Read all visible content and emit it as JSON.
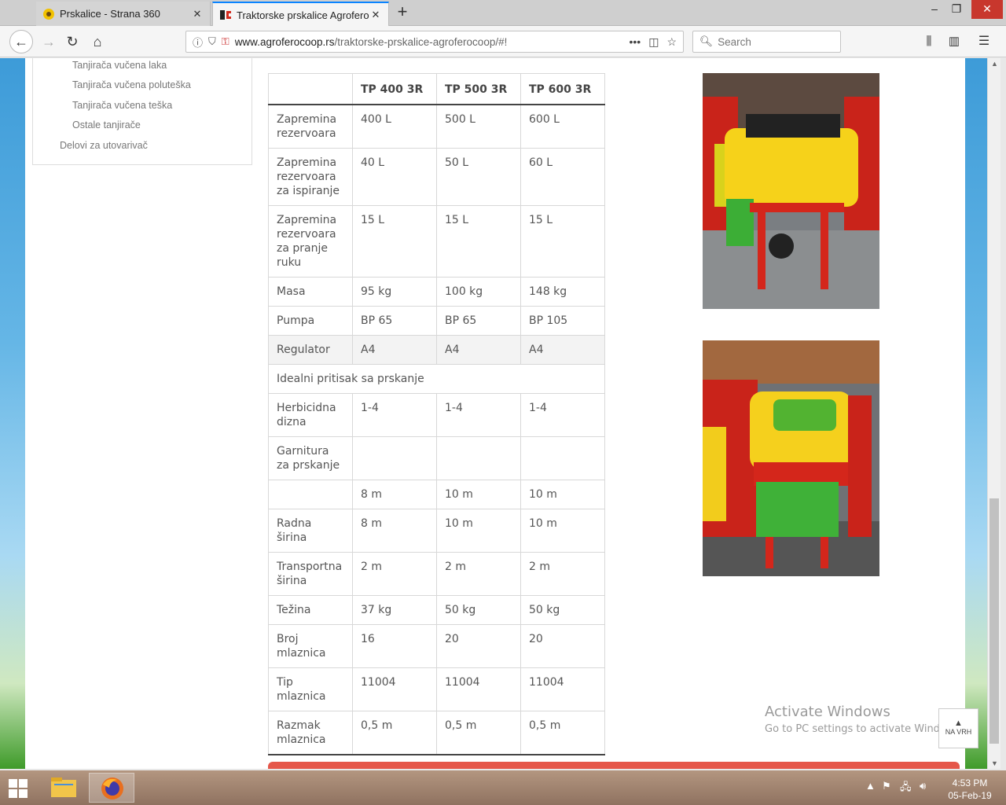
{
  "browser": {
    "tabs": [
      {
        "title": "Prskalice - Strana 360",
        "active": false
      },
      {
        "title": "Traktorske prskalice Agroferoc",
        "active": true
      }
    ],
    "url_host": "www.agroferocoop.rs",
    "url_path": "/traktorske-prskalice-agroferocoop/#!",
    "search_placeholder": "Search"
  },
  "sidebar": {
    "links": [
      "Tanjirača vučena laka",
      "Tanjirača vučena poluteška",
      "Tanjirača vučena teška",
      "Ostale tanjirače",
      "Delovi za utovarivač"
    ]
  },
  "spec_table": {
    "headers": [
      "",
      "TP 400 3R",
      "TP 500 3R",
      "TP 600 3R"
    ],
    "rows": [
      [
        "Zapremina rezervoara",
        "400 L",
        "500 L",
        "600 L"
      ],
      [
        "Zapremina rezervoara za ispiranje",
        "40 L",
        "50 L",
        "60 L"
      ],
      [
        "Zapremina rezervoara za pranje ruku",
        "15 L",
        "15 L",
        "15 L"
      ],
      [
        "Masa",
        "95 kg",
        "100 kg",
        "148 kg"
      ],
      [
        "Pumpa",
        "BP 65",
        "BP 65",
        "BP 105"
      ],
      [
        "Regulator",
        "A4",
        "A4",
        "A4"
      ],
      [
        "Idealni pritisak sa prskanje"
      ],
      [
        "Herbicidna dizna",
        "1-4",
        "1-4",
        "1-4"
      ],
      [
        "Garnitura za prskanje",
        "",
        "",
        ""
      ],
      [
        "",
        "8 m",
        "10 m",
        "10 m"
      ],
      [
        "Radna širina",
        "8 m",
        "10 m",
        "10 m"
      ],
      [
        "Transportna širina",
        "2 m",
        "2 m",
        "2 m"
      ],
      [
        "Težina",
        "37 kg",
        "50 kg",
        "50 kg"
      ],
      [
        "Broj mlaznica",
        "16",
        "20",
        "20"
      ],
      [
        "Tip mlaznica",
        "11004",
        "11004",
        "11004"
      ],
      [
        "Razmak mlaznica",
        "0,5 m",
        "0,5 m",
        "0,5 m"
      ]
    ]
  },
  "watermark": {
    "line1": "Activate Windows",
    "line2": "Go to PC settings to activate Windows."
  },
  "back_to_top": "NA VRH",
  "taskbar": {
    "time": "4:53 PM",
    "date": "05-Feb-19"
  },
  "colors": {
    "accent_red": "#e5574a",
    "tab_accent": "#0a84ff"
  }
}
